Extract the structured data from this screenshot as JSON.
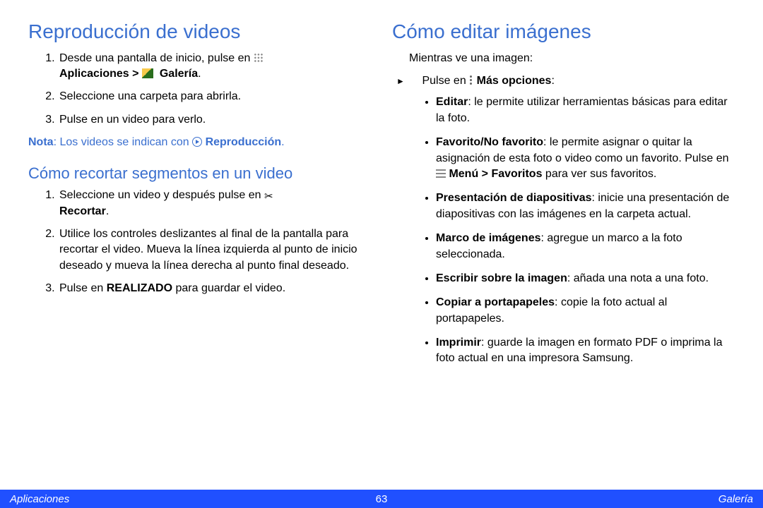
{
  "left": {
    "h1": "Reproducción de videos",
    "ol1": {
      "i1a": "Desde una pantalla de inicio, pulse en ",
      "i1b": "Aplicaciones > ",
      "i1c": "Galería",
      "i1d": ".",
      "i2": "Seleccione una carpeta para abrirla.",
      "i3": "Pulse en un video para verlo."
    },
    "note_label": "Nota",
    "note_text_a": ": Los videos se indican con ",
    "note_text_b": "Reproducción",
    "note_text_c": ".",
    "h2": "Cómo recortar segmentos en un video",
    "ol2": {
      "i1a": "Seleccione un video y después pulse en ",
      "i1b": "Recortar",
      "i1c": ".",
      "i2": "Utilice los controles deslizantes al final de la pantalla para recortar el video. Mueva la línea izquierda al punto de inicio deseado y mueva la línea derecha al punto final deseado.",
      "i3a": "Pulse en ",
      "i3b": "REALIZADO",
      "i3c": " para guardar el video."
    }
  },
  "right": {
    "h1": "Cómo editar imágenes",
    "intro": "Mientras ve una imagen:",
    "arrow_a": "Pulse en ",
    "arrow_b": "Más opciones",
    "arrow_c": ":",
    "items": {
      "i1a": "Editar",
      "i1b": ": le permite utilizar herramientas básicas para editar la foto.",
      "i2a": "Favorito/No favorito",
      "i2b": ": le permite asignar o quitar la asignación de esta foto o video como un favorito. Pulse en ",
      "i2c": "Menú > Favoritos",
      "i2d": " para ver sus favoritos.",
      "i3a": "Presentación de diapositivas",
      "i3b": ": inicie una presentación de diapositivas con las imágenes en la carpeta actual.",
      "i4a": "Marco de imágenes",
      "i4b": ": agregue un marco a la foto seleccionada.",
      "i5a": "Escribir sobre la imagen",
      "i5b": ": añada una nota a una foto.",
      "i6a": "Copiar a portapapeles",
      "i6b": ": copie la foto actual al portapapeles.",
      "i7a": "Imprimir",
      "i7b": ": guarde la imagen en formato PDF o imprima la foto actual en una impresora Samsung."
    }
  },
  "footer": {
    "left": "Aplicaciones",
    "center": "63",
    "right": "Galería"
  }
}
